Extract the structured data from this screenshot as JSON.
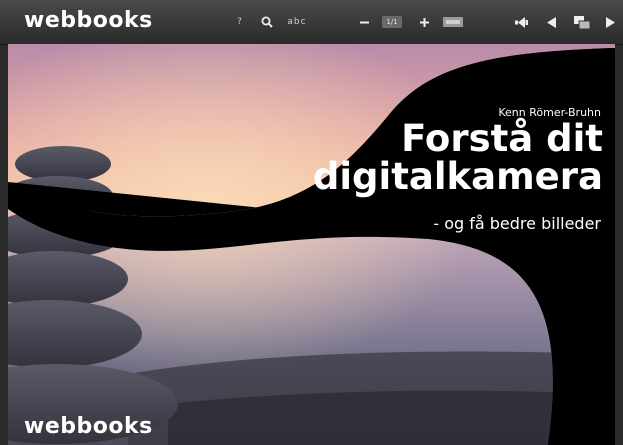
{
  "toolbar": {
    "brand": "webbooks",
    "help_label": "?",
    "text_search_label": "abc",
    "page_indicator": "1/1"
  },
  "cover": {
    "author": "Kenn Römer-Bruhn",
    "title_line1": "Forstå dit",
    "title_line2": "digitalkamera",
    "subtitle": "- og få bedre billeder",
    "brand": "webbooks"
  }
}
